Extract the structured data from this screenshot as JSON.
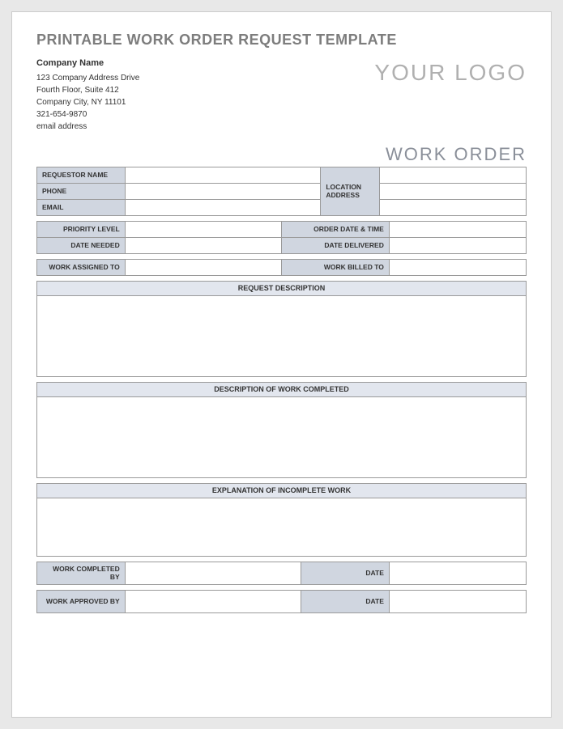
{
  "title": "PRINTABLE WORK ORDER REQUEST TEMPLATE",
  "company": {
    "name": "Company Name",
    "line1": "123 Company Address Drive",
    "line2": "Fourth Floor, Suite 412",
    "line3": "Company City, NY  11101",
    "phone": "321-654-9870",
    "email": "email address"
  },
  "logo": "YOUR LOGO",
  "heading": "WORK ORDER",
  "labels": {
    "requestor": "REQUESTOR NAME",
    "phone": "PHONE",
    "email": "EMAIL",
    "location": "LOCATION ADDRESS",
    "priority": "PRIORITY LEVEL",
    "order_date": "ORDER DATE & TIME",
    "date_needed": "DATE NEEDED",
    "date_delivered": "DATE DELIVERED",
    "assigned_to": "WORK ASSIGNED TO",
    "billed_to": "WORK BILLED TO",
    "request_desc": "REQUEST DESCRIPTION",
    "work_completed_desc": "DESCRIPTION OF WORK COMPLETED",
    "incomplete": "EXPLANATION OF INCOMPLETE WORK",
    "completed_by": "WORK COMPLETED BY",
    "approved_by": "WORK APPROVED BY",
    "date": "DATE"
  },
  "values": {
    "requestor": "",
    "phone": "",
    "email": "",
    "loc1": "",
    "loc2": "",
    "loc3": "",
    "priority": "",
    "order_date": "",
    "date_needed": "",
    "date_delivered": "",
    "assigned_to": "",
    "billed_to": "",
    "request_desc": "",
    "work_completed_desc": "",
    "incomplete": "",
    "completed_by": "",
    "completed_date": "",
    "approved_by": "",
    "approved_date": ""
  }
}
